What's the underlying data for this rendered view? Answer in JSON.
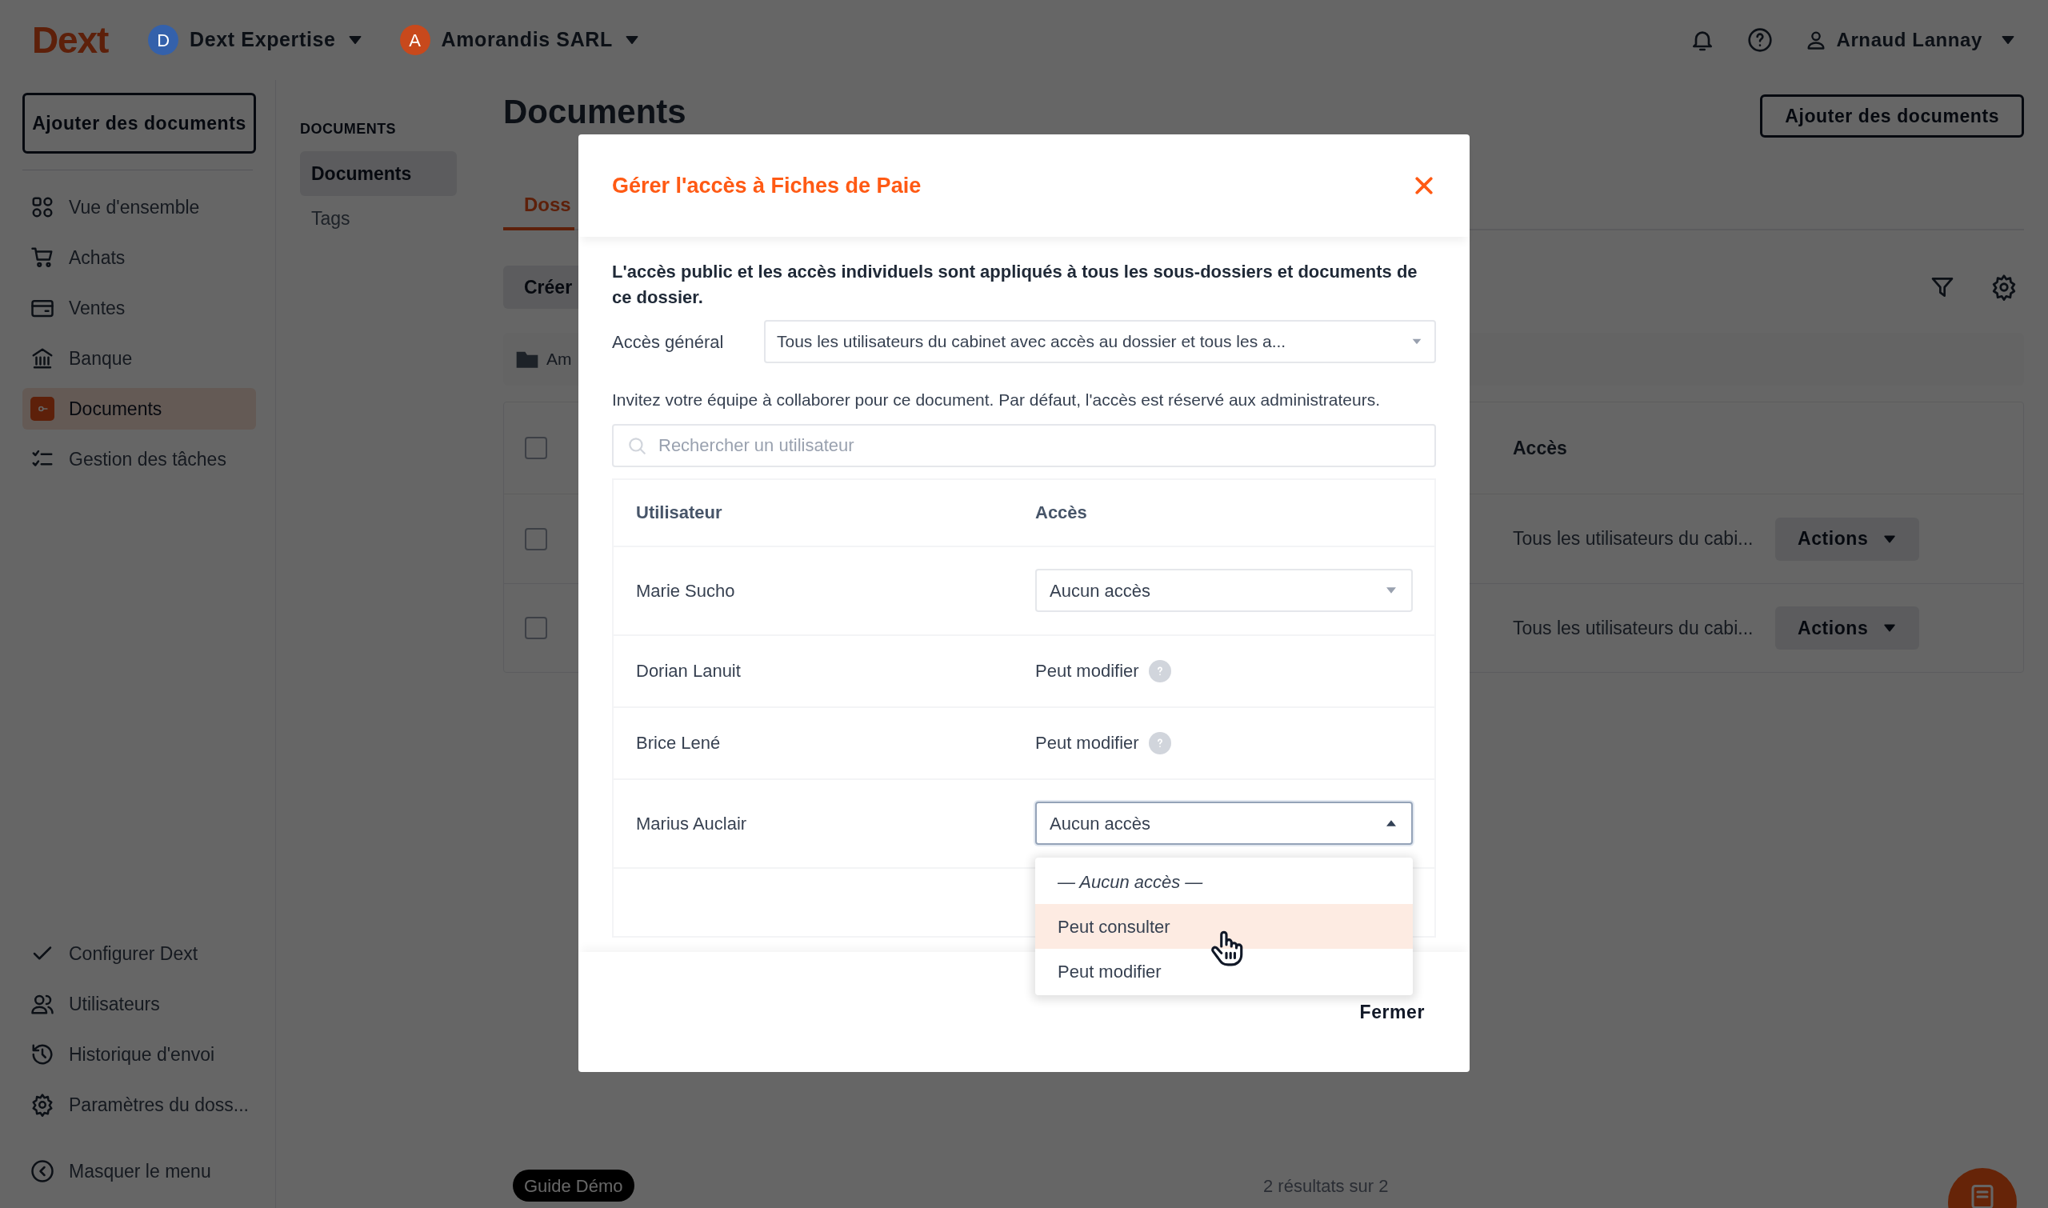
{
  "topbar": {
    "logo": "Dext",
    "workspaces": [
      {
        "initial": "D",
        "name": "Dext Expertise",
        "color": "#3461ab"
      },
      {
        "initial": "A",
        "name": "Amorandis SARL",
        "color": "#c8491c"
      }
    ],
    "user": "Arnaud Lannay"
  },
  "sidebar": {
    "add_button": "Ajouter des documents",
    "items": [
      {
        "kind": "overview",
        "label": "Vue d'ensemble",
        "selected": false
      },
      {
        "kind": "cart",
        "label": "Achats",
        "selected": false
      },
      {
        "kind": "card",
        "label": "Ventes",
        "selected": false
      },
      {
        "kind": "bank",
        "label": "Banque",
        "selected": false
      },
      {
        "kind": "documents",
        "label": "Documents",
        "selected": true
      },
      {
        "kind": "tasks",
        "label": "Gestion des tâches",
        "selected": false
      }
    ],
    "bottom_items": [
      {
        "kind": "check",
        "label": "Configurer Dext"
      },
      {
        "kind": "users",
        "label": "Utilisateurs"
      },
      {
        "kind": "history",
        "label": "Historique d'envoi"
      },
      {
        "kind": "settings",
        "label": "Paramètres du doss..."
      }
    ],
    "collapse": "Masquer le menu"
  },
  "subnav": {
    "heading": "DOCUMENTS",
    "items": [
      {
        "label": "Documents",
        "selected": true
      },
      {
        "label": "Tags",
        "selected": false
      }
    ]
  },
  "main": {
    "title": "Documents",
    "add_button": "Ajouter des documents",
    "tab": "Doss",
    "create_button": "Créer",
    "folder": "Am",
    "table": {
      "column": "Accès",
      "all_checked": false,
      "rows": [
        {
          "access": "Tous les utilisateurs du cabi...",
          "action": "Actions",
          "checked": false
        },
        {
          "access": "Tous les utilisateurs du cabi...",
          "action": "Actions",
          "checked": false
        }
      ]
    },
    "results": "2 résultats sur 2"
  },
  "guide_button": "Guide Démo",
  "modal": {
    "title": "Gérer l'accès à Fiches de Paie",
    "notice": "L'accès public et les accès individuels sont appliqués à tous les sous-dossiers et documents de ce dossier.",
    "general_access": {
      "label": "Accès général",
      "value": "Tous les utilisateurs du cabinet avec accès au dossier et tous les a..."
    },
    "invite_text": "Invitez votre équipe à collaborer pour ce document. Par défaut, l'accès est réservé aux administrateurs.",
    "search": {
      "placeholder": "Rechercher un utilisateur"
    },
    "table": {
      "columns": [
        "Utilisateur",
        "Accès"
      ],
      "rows": [
        {
          "user": "Marie Sucho",
          "kind": "select",
          "access": "Aucun accès",
          "expanded": false
        },
        {
          "user": "Dorian Lanuit",
          "kind": "fixed",
          "access": "Peut modifier"
        },
        {
          "user": "Brice Lené",
          "kind": "fixed",
          "access": "Peut modifier"
        },
        {
          "user": "Marius Auclair",
          "kind": "select",
          "access": "Aucun accès",
          "expanded": true,
          "options": [
            {
              "label": "— Aucun accès —",
              "kind": "placeholder",
              "selected": false
            },
            {
              "label": "Peut consulter",
              "kind": "option",
              "selected": true
            },
            {
              "label": "Peut modifier",
              "kind": "option",
              "selected": false
            }
          ]
        }
      ]
    },
    "close_button": "Fermer"
  }
}
